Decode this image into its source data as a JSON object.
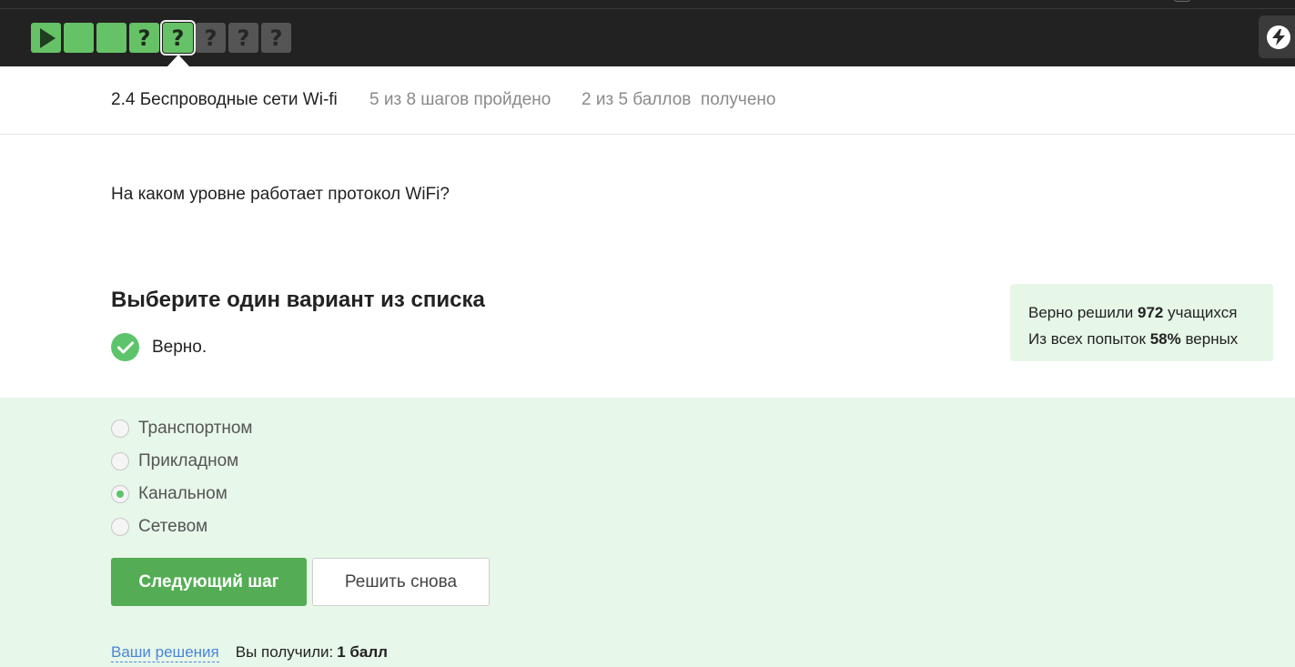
{
  "steps": [
    {
      "type": "play",
      "label": ""
    },
    {
      "type": "passed",
      "label": ""
    },
    {
      "type": "passed",
      "label": ""
    },
    {
      "type": "question",
      "label": "?"
    },
    {
      "type": "current",
      "label": "?"
    },
    {
      "type": "locked",
      "label": "?"
    },
    {
      "type": "locked",
      "label": "?"
    },
    {
      "type": "locked",
      "label": "?"
    }
  ],
  "lesson": {
    "title": "2.4 Беспроводные сети Wi-fi",
    "progress": "5 из 8 шагов пройдено",
    "score": "2 из 5 баллов  получено"
  },
  "question": "На каком уровне работает протокол WiFi?",
  "choose_title": "Выберите один вариант из списка",
  "verdict": "Верно.",
  "stats": {
    "solved_prefix": "Верно решили ",
    "solved_count": "972",
    "solved_suffix": " учащихся",
    "attempts_prefix": "Из всех попыток ",
    "attempts_percent": "58%",
    "attempts_suffix": " верных"
  },
  "options": [
    {
      "label": "Транспортном",
      "selected": false
    },
    {
      "label": "Прикладном",
      "selected": false
    },
    {
      "label": "Канальном",
      "selected": true
    },
    {
      "label": "Сетевом",
      "selected": false
    }
  ],
  "buttons": {
    "next": "Следующий шаг",
    "retry": "Решить снова"
  },
  "footer": {
    "solutions_link": "Ваши решения",
    "got_label": "Вы получили:",
    "got_value": "1 балл"
  },
  "colors": {
    "accent_green": "#54ad54",
    "step_green": "#66c266",
    "answer_bg": "#e7f7e9"
  }
}
